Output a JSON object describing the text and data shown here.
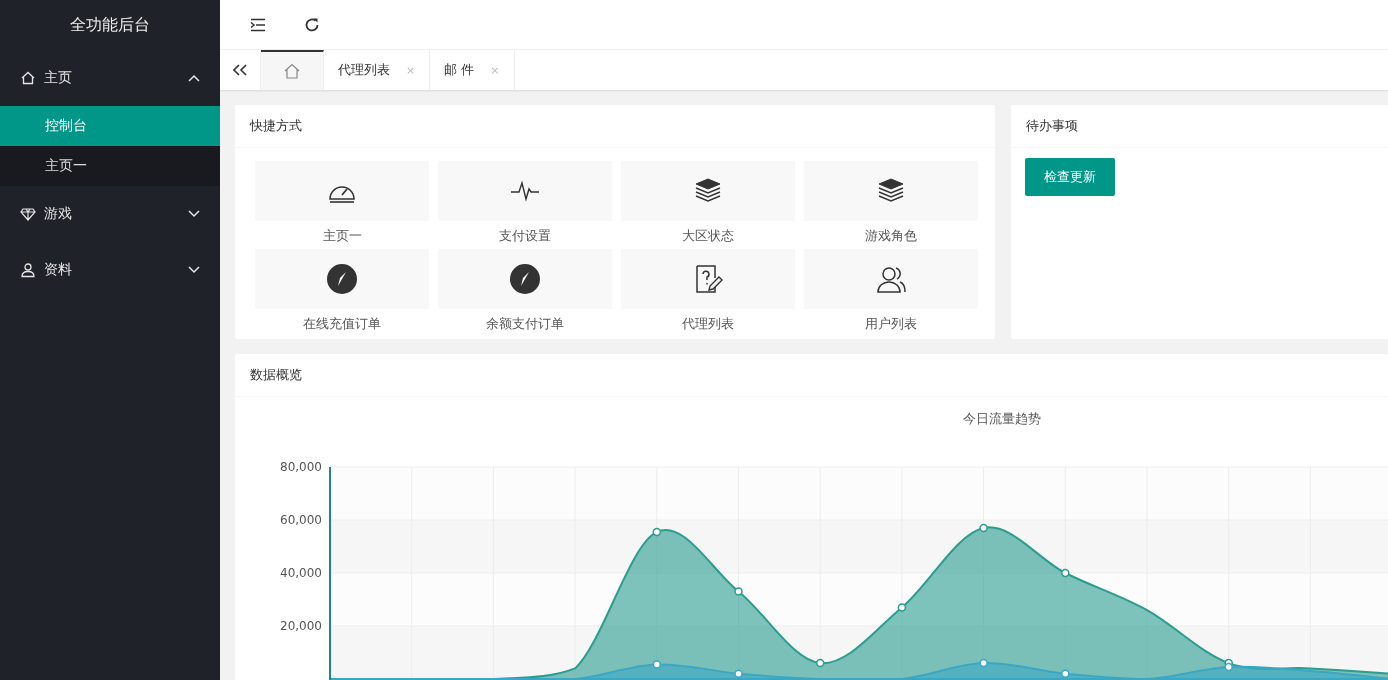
{
  "sidebar": {
    "title": "全功能后台",
    "items": [
      {
        "label": "主页",
        "expanded": true,
        "children": [
          {
            "label": "控制台",
            "selected": true
          },
          {
            "label": "主页一",
            "selected": false
          }
        ]
      },
      {
        "label": "游戏",
        "expanded": false
      },
      {
        "label": "资料",
        "expanded": false
      }
    ]
  },
  "tabs": [
    {
      "kind": "home",
      "selected": true
    },
    {
      "kind": "text",
      "label": "代理列表",
      "close": "×",
      "selected": false
    },
    {
      "kind": "text",
      "label": "邮 件",
      "close": "×",
      "selected": false
    }
  ],
  "shortcuts": {
    "title": "快捷方式",
    "items": [
      {
        "label": "主页一"
      },
      {
        "label": "支付设置"
      },
      {
        "label": "大区状态"
      },
      {
        "label": "游戏角色"
      },
      {
        "label": "在线充值订单"
      },
      {
        "label": "余额支付订单"
      },
      {
        "label": "代理列表"
      },
      {
        "label": "用户列表"
      }
    ]
  },
  "todo": {
    "title": "待办事项",
    "button": "检查更新"
  },
  "overview": {
    "title": "数据概览",
    "chart_data": {
      "type": "area",
      "title": "今日流量趋势",
      "grid": true,
      "ylim": [
        0,
        80000
      ],
      "yticks": [
        {
          "value": 20000,
          "label": "20,000"
        },
        {
          "value": 40000,
          "label": "40,000"
        },
        {
          "value": 60000,
          "label": "60,000"
        },
        {
          "value": 80000,
          "label": "80,000"
        }
      ],
      "series": [
        {
          "color": "#2a9d8f",
          "values": [
            0,
            0,
            0,
            4000,
            55500,
            33000,
            6000,
            27000,
            57000,
            40000,
            26000,
            6000,
            4000,
            2000
          ]
        },
        {
          "color": "#3aa7c4",
          "values": [
            0,
            0,
            0,
            0,
            5500,
            2000,
            0,
            0,
            6000,
            2000,
            0,
            4500,
            3000,
            0
          ]
        }
      ]
    }
  }
}
